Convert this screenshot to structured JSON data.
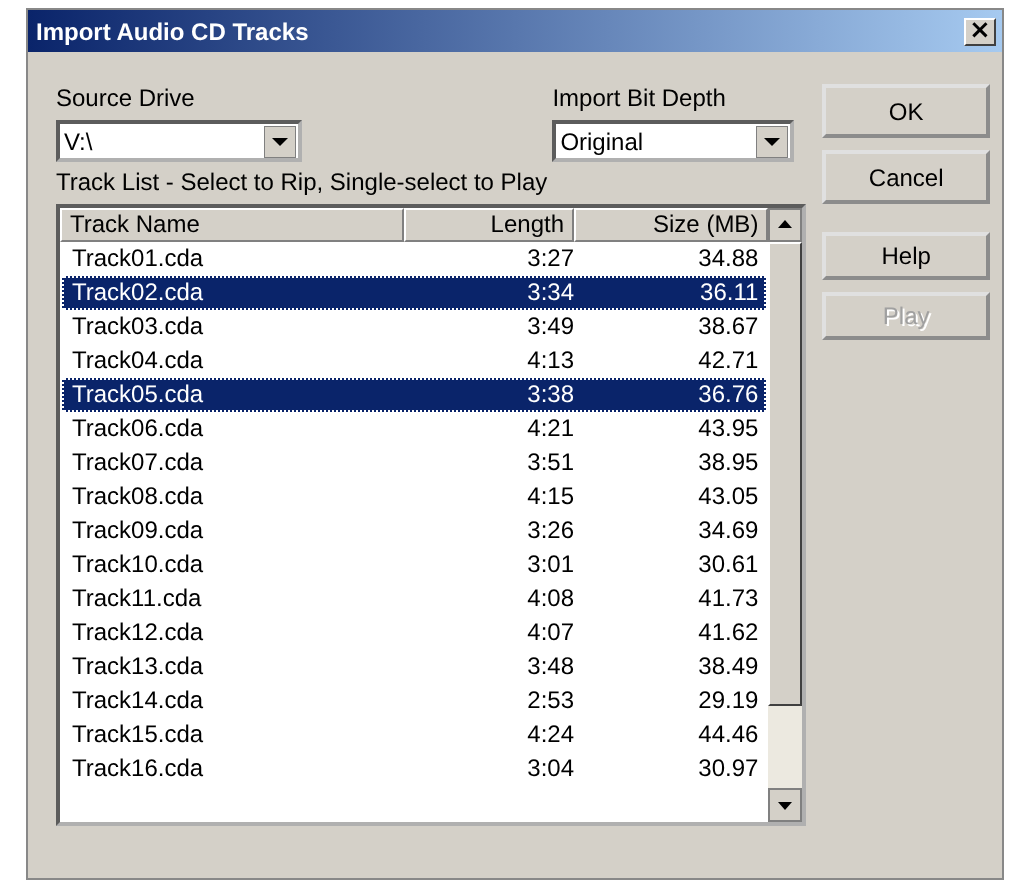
{
  "window": {
    "title": "Import Audio CD Tracks",
    "close": "×"
  },
  "source_drive": {
    "label": "Source Drive",
    "value": "V:\\"
  },
  "bit_depth": {
    "label": "Import Bit Depth",
    "value": "Original"
  },
  "track_list": {
    "label": "Track List - Select to Rip, Single-select to Play",
    "columns": [
      "Track Name",
      "Length",
      "Size (MB)"
    ],
    "rows": [
      {
        "name": "Track01.cda",
        "length": "3:27",
        "size": "34.88",
        "selected": false
      },
      {
        "name": "Track02.cda",
        "length": "3:34",
        "size": "36.11",
        "selected": true
      },
      {
        "name": "Track03.cda",
        "length": "3:49",
        "size": "38.67",
        "selected": false
      },
      {
        "name": "Track04.cda",
        "length": "4:13",
        "size": "42.71",
        "selected": false
      },
      {
        "name": "Track05.cda",
        "length": "3:38",
        "size": "36.76",
        "selected": true
      },
      {
        "name": "Track06.cda",
        "length": "4:21",
        "size": "43.95",
        "selected": false
      },
      {
        "name": "Track07.cda",
        "length": "3:51",
        "size": "38.95",
        "selected": false
      },
      {
        "name": "Track08.cda",
        "length": "4:15",
        "size": "43.05",
        "selected": false
      },
      {
        "name": "Track09.cda",
        "length": "3:26",
        "size": "34.69",
        "selected": false
      },
      {
        "name": "Track10.cda",
        "length": "3:01",
        "size": "30.61",
        "selected": false
      },
      {
        "name": "Track11.cda",
        "length": "4:08",
        "size": "41.73",
        "selected": false
      },
      {
        "name": "Track12.cda",
        "length": "4:07",
        "size": "41.62",
        "selected": false
      },
      {
        "name": "Track13.cda",
        "length": "3:48",
        "size": "38.49",
        "selected": false
      },
      {
        "name": "Track14.cda",
        "length": "2:53",
        "size": "29.19",
        "selected": false
      },
      {
        "name": "Track15.cda",
        "length": "4:24",
        "size": "44.46",
        "selected": false
      },
      {
        "name": "Track16.cda",
        "length": "3:04",
        "size": "30.97",
        "selected": false
      }
    ]
  },
  "buttons": [
    {
      "label": "OK",
      "disabled": false
    },
    {
      "label": "Cancel",
      "disabled": false
    },
    {
      "label": "Help",
      "disabled": false
    },
    {
      "label": "Play",
      "disabled": true
    }
  ]
}
